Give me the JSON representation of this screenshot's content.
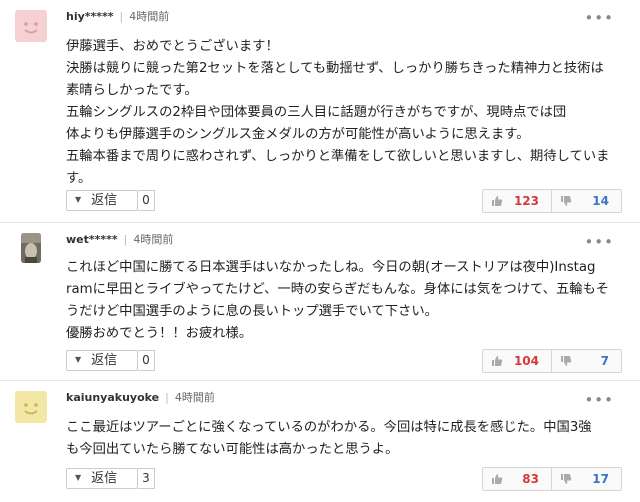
{
  "comments": [
    {
      "username": "hiy*****",
      "time": "4時間前",
      "avatar": "smiley-pink",
      "lines": [
        "伊藤選手、おめでとうございます！",
        "決勝は競りに競った第2セットを落としても動揺せず、しっかり勝ちきった精神力と技術は",
        "素晴らしかったです。",
        "五輪シングルスの2枠目や団体要員の三人目に話題が行きがちですが、現時点では団",
        "体よりも伊藤選手のシングルス金メダルの方が可能性が高いように思えます。",
        "五輪本番まで周りに惑わされず、しっかりと準備をして欲しいと思いますし、期待していま",
        "す。"
      ],
      "reply_label": "返信",
      "reply_count": "0",
      "good": "123",
      "bad": "14"
    },
    {
      "username": "wet*****",
      "time": "4時間前",
      "avatar": "photo",
      "lines": [
        "これほど中国に勝てる日本選手はいなかったしね。今日の朝(オーストリアは夜中)Instag",
        "ramに早田とライブやってたけど、一時の安らぎだもんな。身体には気をつけて、五輪もそ",
        "うだけど中国選手のように息の長いトップ選手でいて下さい。",
        "優勝おめでとう！！お疲れ様。"
      ],
      "reply_label": "返信",
      "reply_count": "0",
      "good": "104",
      "bad": "7"
    },
    {
      "username": "kaiunyakuyoke",
      "time": "4時間前",
      "avatar": "smiley-yellow",
      "lines": [
        "ここ最近はツアーごとに強くなっているのがわかる。今回は特に成長を感じた。中国3強",
        "も今回出ていたら勝てない可能性は高かったと思うよ。"
      ],
      "reply_label": "返信",
      "reply_count": "3",
      "good": "83",
      "bad": "17"
    }
  ],
  "colors": {
    "good": "#d33b3b",
    "bad": "#3b73c8",
    "avatar_pink": "#f6d1d3",
    "avatar_yellow": "#f3e7a6"
  }
}
